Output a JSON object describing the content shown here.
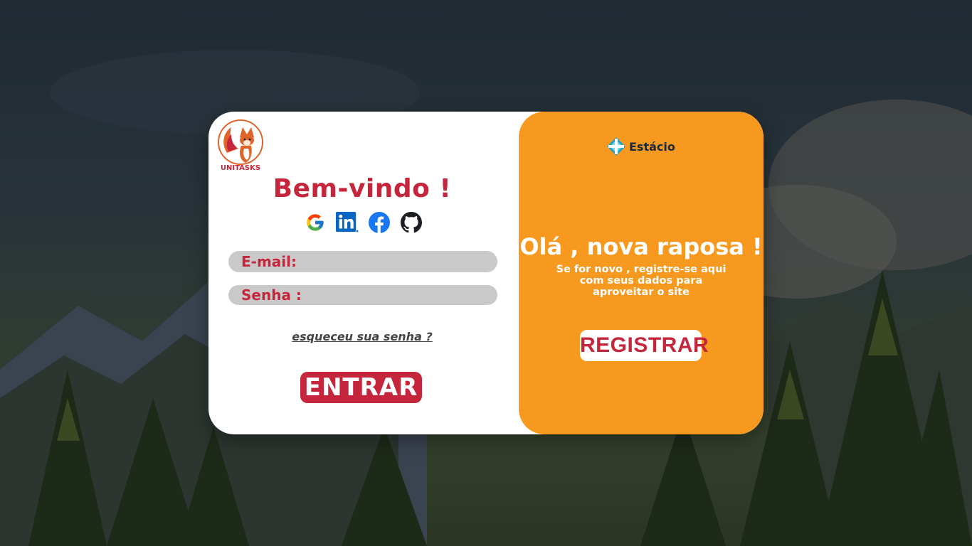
{
  "app": {
    "logo_text": "UNITASKS"
  },
  "login": {
    "title": "Bem-vindo !",
    "social": [
      {
        "icon": "google-icon"
      },
      {
        "icon": "linkedin-icon"
      },
      {
        "icon": "facebook-icon"
      },
      {
        "icon": "github-icon"
      }
    ],
    "email_label": "E-mail:",
    "email_value": "",
    "password_label": "Senha :",
    "password_value": "",
    "forgot_label": "esqueceu sua senha ?",
    "submit_label": "ENTRAR"
  },
  "register": {
    "brand": "Estácio",
    "title": "Olá , nova raposa !",
    "subtitle_lines": [
      "Se for novo , registre-se aqui",
      "com seus dados para",
      "aproveitar o site"
    ],
    "button_label": "REGISTRAR"
  },
  "colors": {
    "accent_red": "#c6263c",
    "panel_orange": "#f7991e",
    "field_gray": "#c9c9c9"
  }
}
